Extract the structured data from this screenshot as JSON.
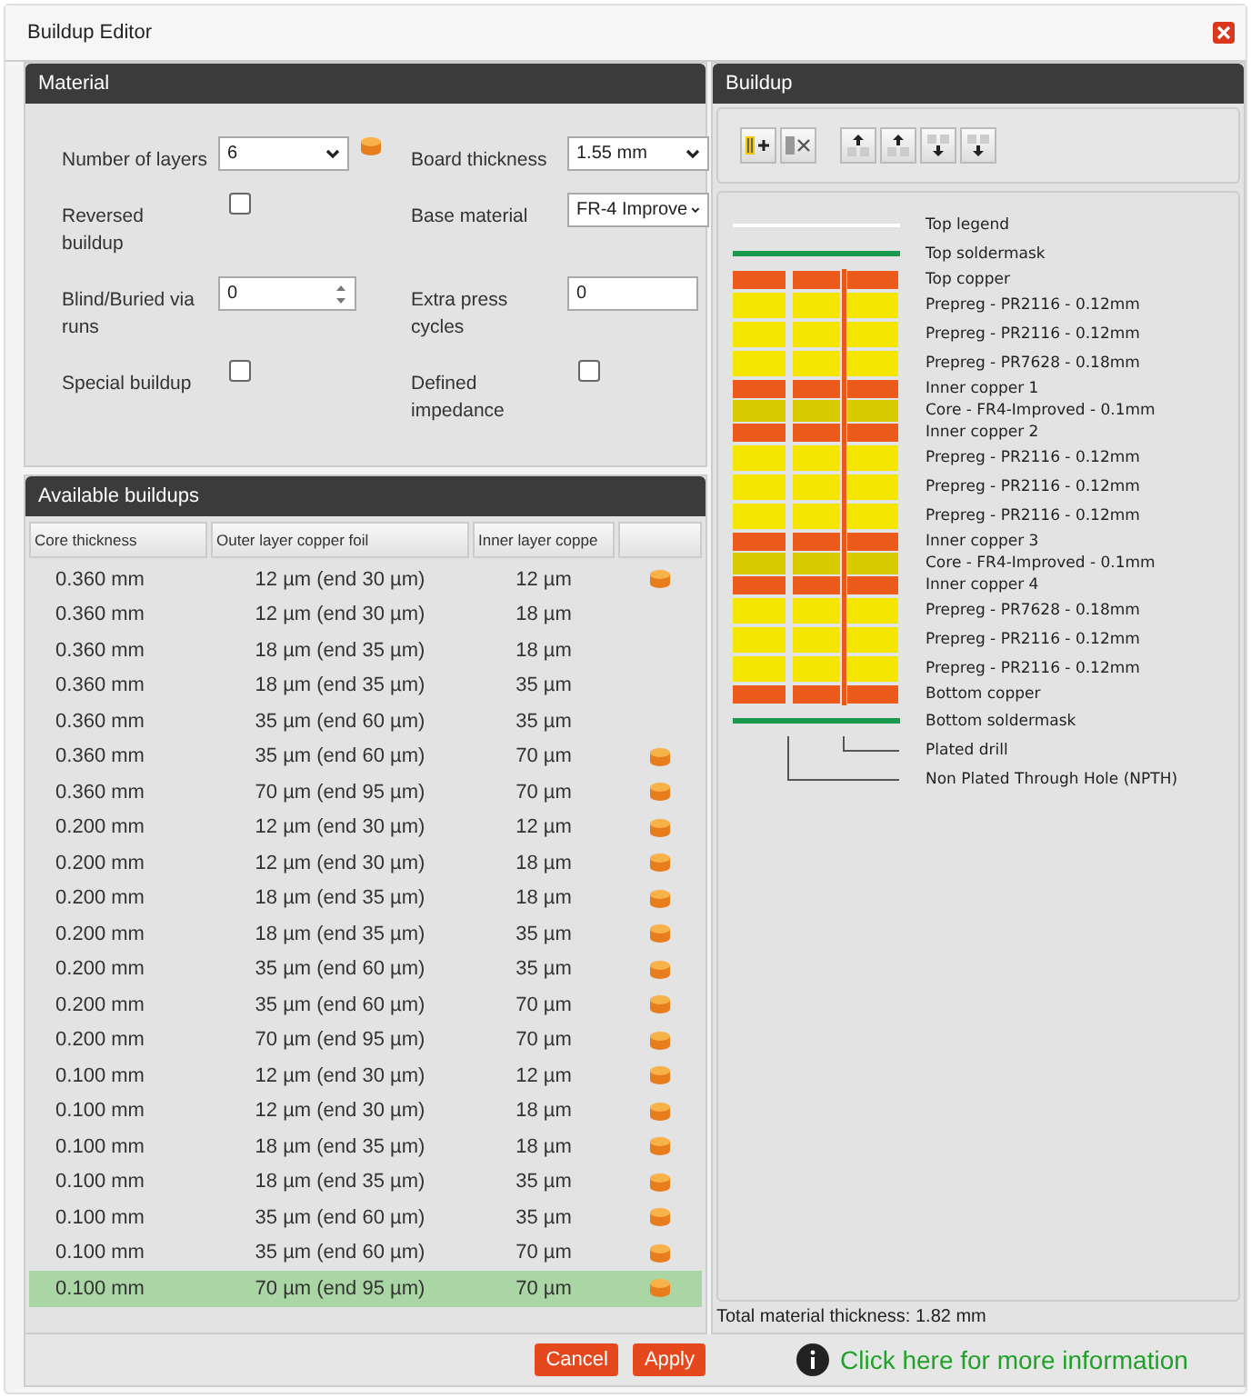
{
  "window": {
    "title": "Buildup Editor"
  },
  "material": {
    "title": "Material",
    "fields": [
      {
        "kind": "select",
        "label": "Number of layers",
        "value": "6",
        "stock": true
      },
      {
        "kind": "select",
        "label": "Board thickness",
        "value": "1.55 mm",
        "stock": false
      },
      {
        "kind": "checkbox",
        "label": "Reversed buildup",
        "stock": false,
        "checked": false
      },
      {
        "kind": "select",
        "label": "Base material",
        "value": "FR-4 Improve",
        "stock": false
      },
      {
        "kind": "spinner",
        "label": "Blind/Buried via runs",
        "value": "0",
        "stock": false
      },
      {
        "kind": "text",
        "label": "Extra press cycles",
        "value": "0",
        "stock": false
      },
      {
        "kind": "checkbox",
        "label": "Special buildup",
        "stock": false,
        "checked": false
      },
      {
        "kind": "checkbox",
        "label": "Defined impedance",
        "stock": false,
        "checked": false
      }
    ]
  },
  "available": {
    "title": "Available buildups",
    "columns": [
      "Core thickness",
      "Outer layer copper foil",
      "Inner layer coppe"
    ],
    "rows": [
      {
        "cells": [
          "0.360 mm",
          "12 µm (end 30 µm)",
          "12 µm"
        ],
        "stock": true,
        "selected": false
      },
      {
        "cells": [
          "0.360 mm",
          "12 µm (end 30 µm)",
          "18 µm"
        ],
        "stock": false,
        "selected": false
      },
      {
        "cells": [
          "0.360 mm",
          "18 µm (end 35 µm)",
          "18 µm"
        ],
        "stock": false,
        "selected": false
      },
      {
        "cells": [
          "0.360 mm",
          "18 µm (end 35 µm)",
          "35 µm"
        ],
        "stock": false,
        "selected": false
      },
      {
        "cells": [
          "0.360 mm",
          "35 µm (end 60 µm)",
          "35 µm"
        ],
        "stock": false,
        "selected": false
      },
      {
        "cells": [
          "0.360 mm",
          "35 µm (end 60 µm)",
          "70 µm"
        ],
        "stock": true,
        "selected": false
      },
      {
        "cells": [
          "0.360 mm",
          "70 µm (end 95 µm)",
          "70 µm"
        ],
        "stock": true,
        "selected": false
      },
      {
        "cells": [
          "0.200 mm",
          "12 µm (end 30 µm)",
          "12 µm"
        ],
        "stock": true,
        "selected": false
      },
      {
        "cells": [
          "0.200 mm",
          "12 µm (end 30 µm)",
          "18 µm"
        ],
        "stock": true,
        "selected": false
      },
      {
        "cells": [
          "0.200 mm",
          "18 µm (end 35 µm)",
          "18 µm"
        ],
        "stock": true,
        "selected": false
      },
      {
        "cells": [
          "0.200 mm",
          "18 µm (end 35 µm)",
          "35 µm"
        ],
        "stock": true,
        "selected": false
      },
      {
        "cells": [
          "0.200 mm",
          "35 µm (end 60 µm)",
          "35 µm"
        ],
        "stock": true,
        "selected": false
      },
      {
        "cells": [
          "0.200 mm",
          "35 µm (end 60 µm)",
          "70 µm"
        ],
        "stock": true,
        "selected": false
      },
      {
        "cells": [
          "0.200 mm",
          "70 µm (end 95 µm)",
          "70 µm"
        ],
        "stock": true,
        "selected": false
      },
      {
        "cells": [
          "0.100 mm",
          "12 µm (end 30 µm)",
          "12 µm"
        ],
        "stock": true,
        "selected": false
      },
      {
        "cells": [
          "0.100 mm",
          "12 µm (end 30 µm)",
          "18 µm"
        ],
        "stock": true,
        "selected": false
      },
      {
        "cells": [
          "0.100 mm",
          "18 µm (end 35 µm)",
          "18 µm"
        ],
        "stock": true,
        "selected": false
      },
      {
        "cells": [
          "0.100 mm",
          "18 µm (end 35 µm)",
          "35 µm"
        ],
        "stock": true,
        "selected": false
      },
      {
        "cells": [
          "0.100 mm",
          "35 µm (end 60 µm)",
          "35 µm"
        ],
        "stock": true,
        "selected": false
      },
      {
        "cells": [
          "0.100 mm",
          "35 µm (end 60 µm)",
          "70 µm"
        ],
        "stock": true,
        "selected": false
      },
      {
        "cells": [
          "0.100 mm",
          "70 µm (end 95 µm)",
          "70 µm"
        ],
        "stock": true,
        "selected": true
      }
    ]
  },
  "buildup": {
    "title": "Buildup",
    "layers": [
      {
        "kind": "legend",
        "label": "Top legend"
      },
      {
        "kind": "soldermask",
        "label": "Top soldermask"
      },
      {
        "kind": "copper",
        "label": "Top copper"
      },
      {
        "kind": "prepreg",
        "label": "Prepreg - PR2116 - 0.12mm"
      },
      {
        "kind": "prepreg",
        "label": "Prepreg - PR2116 - 0.12mm"
      },
      {
        "kind": "prepreg",
        "label": "Prepreg - PR7628 - 0.18mm"
      },
      {
        "kind": "copper",
        "label": "Inner copper 1"
      },
      {
        "kind": "core",
        "label": "Core - FR4-Improved - 0.1mm"
      },
      {
        "kind": "copper",
        "label": "Inner copper 2"
      },
      {
        "kind": "prepreg",
        "label": "Prepreg - PR2116 - 0.12mm"
      },
      {
        "kind": "prepreg",
        "label": "Prepreg - PR2116 - 0.12mm"
      },
      {
        "kind": "prepreg",
        "label": "Prepreg - PR2116 - 0.12mm"
      },
      {
        "kind": "copper",
        "label": "Inner copper 3"
      },
      {
        "kind": "core",
        "label": "Core - FR4-Improved - 0.1mm"
      },
      {
        "kind": "copper",
        "label": "Inner copper 4"
      },
      {
        "kind": "prepreg",
        "label": "Prepreg - PR7628 - 0.18mm"
      },
      {
        "kind": "prepreg",
        "label": "Prepreg - PR2116 - 0.12mm"
      },
      {
        "kind": "prepreg",
        "label": "Prepreg - PR2116 - 0.12mm"
      },
      {
        "kind": "copper",
        "label": "Bottom copper"
      },
      {
        "kind": "soldermask",
        "label": "Bottom soldermask"
      },
      {
        "kind": "drill",
        "label": "Plated drill"
      },
      {
        "kind": "npth",
        "label": "Non Plated Through Hole (NPTH)"
      }
    ],
    "total": "Total material thickness: 1.82 mm"
  },
  "footer": {
    "buttons": [
      "Cancel",
      "Apply"
    ],
    "info_link": "Click here for more information"
  }
}
